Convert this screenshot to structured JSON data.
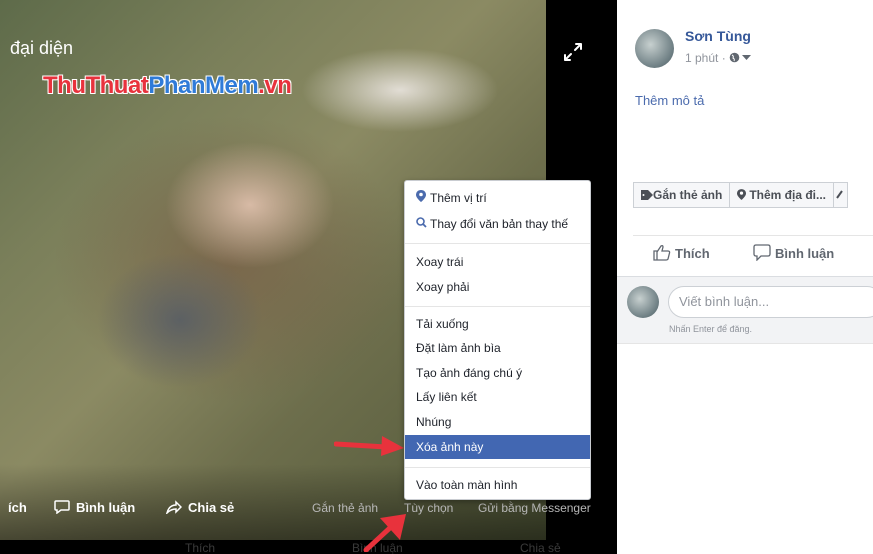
{
  "photo": {
    "title": "đại diện",
    "watermark_part1": "ThuThuat",
    "watermark_part2": "PhanMem",
    "watermark_part3": ".vn",
    "bottom_bar": {
      "like_partial": "ích",
      "comment": "Bình luận",
      "share": "Chia sẻ",
      "tag_photo": "Gắn thẻ ảnh",
      "options": "Tùy chọn",
      "send_messenger": "Gửi bằng Messenger"
    },
    "ghost_row": {
      "like": "Thích",
      "comment": "Bình luận",
      "share": "Chia sẻ"
    }
  },
  "menu": {
    "items": [
      {
        "label": "Thêm vị trí",
        "icon": "location-pin-icon"
      },
      {
        "label": "Thay đổi văn bản thay thế",
        "icon": "search-icon"
      },
      {
        "label": "Xoay trái"
      },
      {
        "label": "Xoay phải"
      },
      {
        "label": "Tải xuống"
      },
      {
        "label": "Đặt làm ảnh bìa"
      },
      {
        "label": "Tạo ảnh đáng chú ý"
      },
      {
        "label": "Lấy liên kết"
      },
      {
        "label": "Nhúng"
      },
      {
        "label": "Xóa ảnh này",
        "highlighted": true
      },
      {
        "label": "Vào toàn màn hình"
      }
    ],
    "highlight_color": "#4267b2"
  },
  "panel": {
    "author": "Sơn Tùng",
    "time": "1 phút ·",
    "add_description": "Thêm mô tả",
    "tag_buttons": [
      "Gắn thẻ ảnh",
      "Thêm địa đi..."
    ],
    "actions": {
      "like": "Thích",
      "comment": "Bình luận"
    },
    "comment_placeholder": "Viết bình luận...",
    "comment_hint": "Nhấn Enter để đăng."
  },
  "colors": {
    "link_blue": "#365899",
    "arrow_red": "#e8323c"
  }
}
